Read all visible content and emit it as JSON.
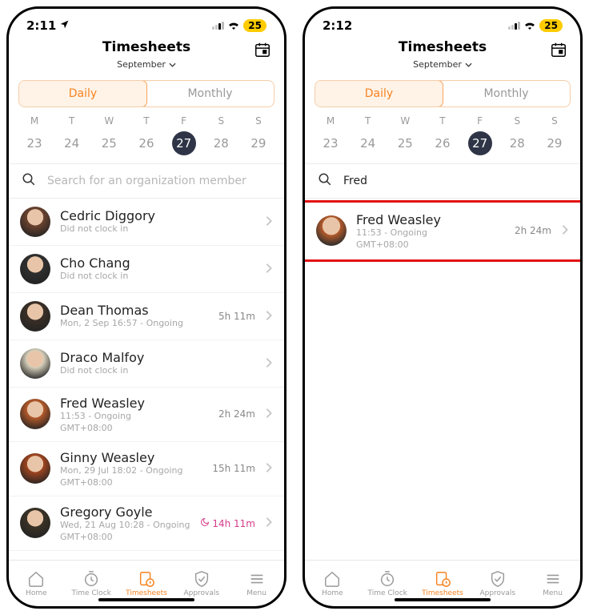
{
  "accent": "#f68322",
  "phoneA": {
    "status_time": "2:11",
    "battery": "25",
    "title": "Timesheets",
    "month": "September",
    "tabs": {
      "daily": "Daily",
      "monthly": "Monthly"
    },
    "days": {
      "labels": [
        "M",
        "T",
        "W",
        "T",
        "F",
        "S",
        "S"
      ],
      "nums": [
        "23",
        "24",
        "25",
        "26",
        "27",
        "28",
        "29"
      ],
      "selected_index": 4
    },
    "search_placeholder": "Search for an organization member",
    "search_value": "",
    "members": [
      {
        "name": "Cedric Diggory",
        "line1": "Did not clock in",
        "line2": "",
        "duration": "",
        "warn": false,
        "avatar": "#6b432f"
      },
      {
        "name": "Cho Chang",
        "line1": "Did not clock in",
        "line2": "",
        "duration": "",
        "warn": false,
        "avatar": "#2f2f2f"
      },
      {
        "name": "Dean Thomas",
        "line1": "Mon, 2 Sep 16:57 - Ongoing",
        "line2": "",
        "duration": "5h 11m",
        "warn": false,
        "avatar": "#3a2f26"
      },
      {
        "name": "Draco Malfoy",
        "line1": "Did not clock in",
        "line2": "",
        "duration": "",
        "warn": false,
        "avatar": "#d9d2be"
      },
      {
        "name": "Fred Weasley",
        "line1": "11:53 - Ongoing",
        "line2": "GMT+08:00",
        "duration": "2h 24m",
        "warn": false,
        "avatar": "#b45a2a"
      },
      {
        "name": "Ginny Weasley",
        "line1": "Mon, 29 Jul 18:02 - Ongoing",
        "line2": "GMT+08:00",
        "duration": "15h 11m",
        "warn": false,
        "avatar": "#a0451f"
      },
      {
        "name": "Gregory Goyle",
        "line1": "Wed, 21 Aug 10:28 - Ongoing",
        "line2": "GMT+08:00",
        "duration": "14h 11m",
        "warn": true,
        "avatar": "#3a3226"
      }
    ],
    "tabbar": [
      "Home",
      "Time Clock",
      "Timesheets",
      "Approvals",
      "Menu"
    ]
  },
  "phoneB": {
    "status_time": "2:12",
    "battery": "25",
    "title": "Timesheets",
    "month": "September",
    "tabs": {
      "daily": "Daily",
      "monthly": "Monthly"
    },
    "days": {
      "labels": [
        "M",
        "T",
        "W",
        "T",
        "F",
        "S",
        "S"
      ],
      "nums": [
        "23",
        "24",
        "25",
        "26",
        "27",
        "28",
        "29"
      ],
      "selected_index": 4
    },
    "search_placeholder": "",
    "search_value": "Fred",
    "result": {
      "name": "Fred Weasley",
      "line1": "11:53 - Ongoing",
      "line2": "GMT+08:00",
      "duration": "2h 24m",
      "avatar": "#b45a2a"
    },
    "tabbar": [
      "Home",
      "Time Clock",
      "Timesheets",
      "Approvals",
      "Menu"
    ]
  }
}
